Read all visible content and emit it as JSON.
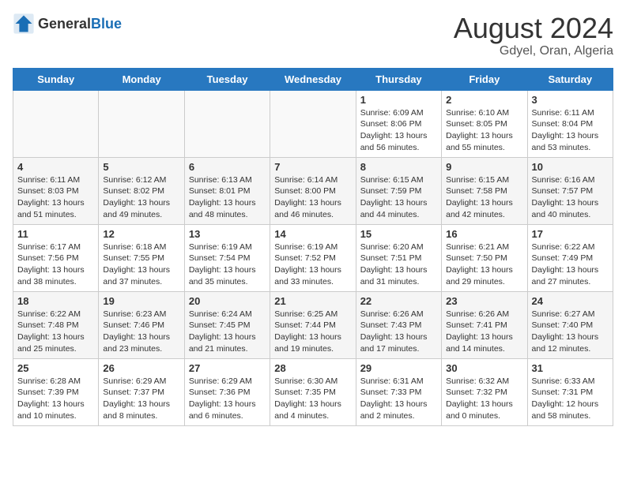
{
  "header": {
    "logo_general": "General",
    "logo_blue": "Blue",
    "month_year": "August 2024",
    "location": "Gdyel, Oran, Algeria"
  },
  "weekdays": [
    "Sunday",
    "Monday",
    "Tuesday",
    "Wednesday",
    "Thursday",
    "Friday",
    "Saturday"
  ],
  "weeks": [
    [
      {
        "day": "",
        "empty": true
      },
      {
        "day": "",
        "empty": true
      },
      {
        "day": "",
        "empty": true
      },
      {
        "day": "",
        "empty": true
      },
      {
        "day": "1",
        "sunrise": "6:09 AM",
        "sunset": "8:06 PM",
        "daylight": "13 hours and 56 minutes."
      },
      {
        "day": "2",
        "sunrise": "6:10 AM",
        "sunset": "8:05 PM",
        "daylight": "13 hours and 55 minutes."
      },
      {
        "day": "3",
        "sunrise": "6:11 AM",
        "sunset": "8:04 PM",
        "daylight": "13 hours and 53 minutes."
      }
    ],
    [
      {
        "day": "4",
        "sunrise": "6:11 AM",
        "sunset": "8:03 PM",
        "daylight": "13 hours and 51 minutes."
      },
      {
        "day": "5",
        "sunrise": "6:12 AM",
        "sunset": "8:02 PM",
        "daylight": "13 hours and 49 minutes."
      },
      {
        "day": "6",
        "sunrise": "6:13 AM",
        "sunset": "8:01 PM",
        "daylight": "13 hours and 48 minutes."
      },
      {
        "day": "7",
        "sunrise": "6:14 AM",
        "sunset": "8:00 PM",
        "daylight": "13 hours and 46 minutes."
      },
      {
        "day": "8",
        "sunrise": "6:15 AM",
        "sunset": "7:59 PM",
        "daylight": "13 hours and 44 minutes."
      },
      {
        "day": "9",
        "sunrise": "6:15 AM",
        "sunset": "7:58 PM",
        "daylight": "13 hours and 42 minutes."
      },
      {
        "day": "10",
        "sunrise": "6:16 AM",
        "sunset": "7:57 PM",
        "daylight": "13 hours and 40 minutes."
      }
    ],
    [
      {
        "day": "11",
        "sunrise": "6:17 AM",
        "sunset": "7:56 PM",
        "daylight": "13 hours and 38 minutes."
      },
      {
        "day": "12",
        "sunrise": "6:18 AM",
        "sunset": "7:55 PM",
        "daylight": "13 hours and 37 minutes."
      },
      {
        "day": "13",
        "sunrise": "6:19 AM",
        "sunset": "7:54 PM",
        "daylight": "13 hours and 35 minutes."
      },
      {
        "day": "14",
        "sunrise": "6:19 AM",
        "sunset": "7:52 PM",
        "daylight": "13 hours and 33 minutes."
      },
      {
        "day": "15",
        "sunrise": "6:20 AM",
        "sunset": "7:51 PM",
        "daylight": "13 hours and 31 minutes."
      },
      {
        "day": "16",
        "sunrise": "6:21 AM",
        "sunset": "7:50 PM",
        "daylight": "13 hours and 29 minutes."
      },
      {
        "day": "17",
        "sunrise": "6:22 AM",
        "sunset": "7:49 PM",
        "daylight": "13 hours and 27 minutes."
      }
    ],
    [
      {
        "day": "18",
        "sunrise": "6:22 AM",
        "sunset": "7:48 PM",
        "daylight": "13 hours and 25 minutes."
      },
      {
        "day": "19",
        "sunrise": "6:23 AM",
        "sunset": "7:46 PM",
        "daylight": "13 hours and 23 minutes."
      },
      {
        "day": "20",
        "sunrise": "6:24 AM",
        "sunset": "7:45 PM",
        "daylight": "13 hours and 21 minutes."
      },
      {
        "day": "21",
        "sunrise": "6:25 AM",
        "sunset": "7:44 PM",
        "daylight": "13 hours and 19 minutes."
      },
      {
        "day": "22",
        "sunrise": "6:26 AM",
        "sunset": "7:43 PM",
        "daylight": "13 hours and 17 minutes."
      },
      {
        "day": "23",
        "sunrise": "6:26 AM",
        "sunset": "7:41 PM",
        "daylight": "13 hours and 14 minutes."
      },
      {
        "day": "24",
        "sunrise": "6:27 AM",
        "sunset": "7:40 PM",
        "daylight": "13 hours and 12 minutes."
      }
    ],
    [
      {
        "day": "25",
        "sunrise": "6:28 AM",
        "sunset": "7:39 PM",
        "daylight": "13 hours and 10 minutes."
      },
      {
        "day": "26",
        "sunrise": "6:29 AM",
        "sunset": "7:37 PM",
        "daylight": "13 hours and 8 minutes."
      },
      {
        "day": "27",
        "sunrise": "6:29 AM",
        "sunset": "7:36 PM",
        "daylight": "13 hours and 6 minutes."
      },
      {
        "day": "28",
        "sunrise": "6:30 AM",
        "sunset": "7:35 PM",
        "daylight": "13 hours and 4 minutes."
      },
      {
        "day": "29",
        "sunrise": "6:31 AM",
        "sunset": "7:33 PM",
        "daylight": "13 hours and 2 minutes."
      },
      {
        "day": "30",
        "sunrise": "6:32 AM",
        "sunset": "7:32 PM",
        "daylight": "13 hours and 0 minutes."
      },
      {
        "day": "31",
        "sunrise": "6:33 AM",
        "sunset": "7:31 PM",
        "daylight": "12 hours and 58 minutes."
      }
    ]
  ]
}
